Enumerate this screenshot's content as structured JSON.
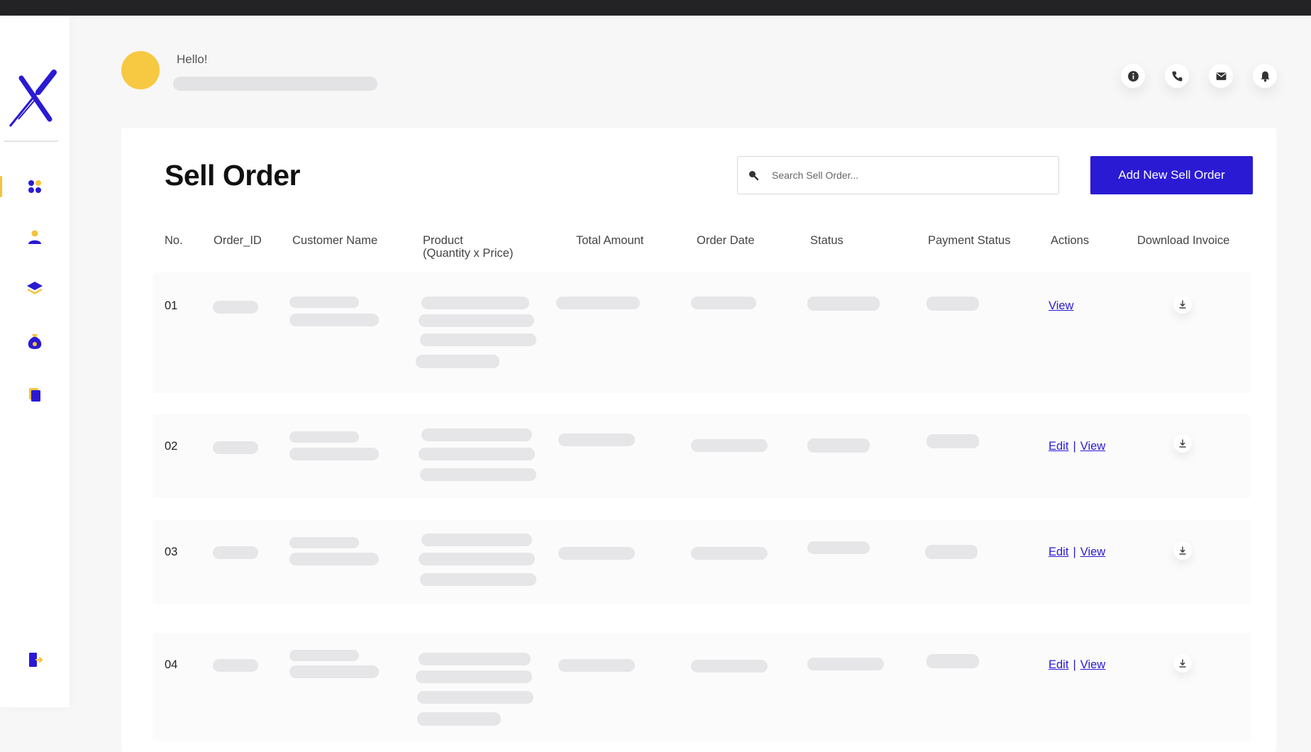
{
  "header": {
    "greeting": "Hello!"
  },
  "page": {
    "title": "Sell Order",
    "search_placeholder": "Search Sell Order...",
    "add_button": "Add New Sell Order"
  },
  "table": {
    "headers": [
      "No.",
      "Order_ID",
      "Customer Name",
      "Product",
      "(Quantity x Price)",
      "Total Amount",
      "Order Date",
      "Status",
      "Payment Status",
      "Actions",
      "Download Invoice"
    ],
    "rows": [
      {
        "no": "01",
        "actions": [
          "View"
        ]
      },
      {
        "no": "02",
        "actions": [
          "Edit",
          "View"
        ]
      },
      {
        "no": "03",
        "actions": [
          "Edit",
          "View"
        ]
      },
      {
        "no": "04",
        "actions": [
          "Edit",
          "View"
        ]
      }
    ],
    "action_separator": "|"
  },
  "colors": {
    "accent": "#2a1ad4",
    "highlight": "#f5c33b",
    "avatar": "#f7c842",
    "topbar": "#232325"
  },
  "icons": {
    "sidebar": [
      "dashboard-icon",
      "user-icon",
      "layers-icon",
      "money-bag-icon",
      "document-icon",
      "logout-icon"
    ],
    "header": [
      "info-icon",
      "phone-icon",
      "mail-icon",
      "bell-icon"
    ],
    "row": "download-icon",
    "search": "search-icon"
  }
}
